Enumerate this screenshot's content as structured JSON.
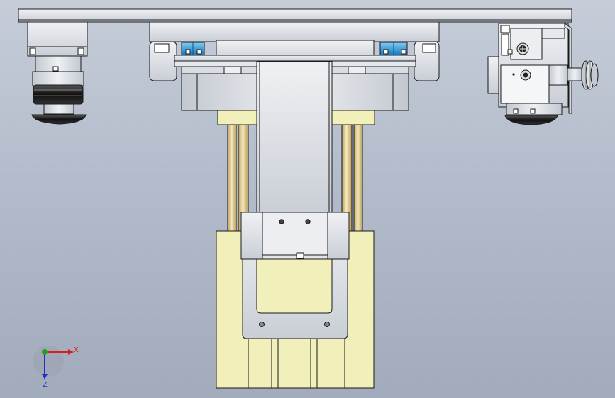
{
  "triad": {
    "x_label": "X",
    "z_label": "Z",
    "x_color": "#d42020",
    "z_color": "#2030c8",
    "y_color": "#20a020"
  },
  "colors": {
    "background_top": "#c6cdd9",
    "background_bottom": "#a2abbb",
    "steel": "#dde0e6",
    "steel_dark": "#aeb4be",
    "brass": "#f2f0ba",
    "rod": "#e3cf95",
    "accent_blue": "#1d8fd6",
    "rubber": "#1c1c1c"
  }
}
